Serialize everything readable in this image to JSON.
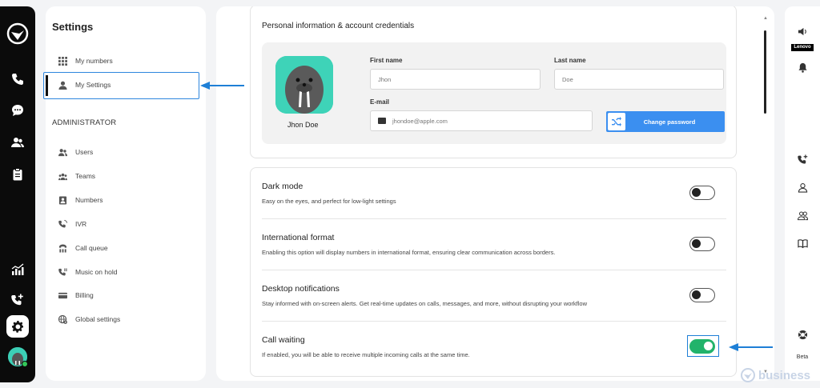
{
  "app": {
    "logo": "app-logo-icon"
  },
  "left_rail": {
    "icons": [
      "phone-icon",
      "chat-icon",
      "contacts-icon",
      "clipboard-icon",
      "analytics-icon",
      "add-call-icon",
      "gear-icon",
      "avatar"
    ]
  },
  "settings": {
    "title": "Settings",
    "items": [
      {
        "label": "My numbers",
        "icon": "grid-icon"
      },
      {
        "label": "My Settings",
        "icon": "user-icon"
      }
    ],
    "admin_label": "ADMINISTRATOR",
    "admin_items": [
      {
        "label": "Users",
        "icon": "users-icon"
      },
      {
        "label": "Teams",
        "icon": "teams-icon"
      },
      {
        "label": "Numbers",
        "icon": "numbers-icon"
      },
      {
        "label": "IVR",
        "icon": "ivr-icon"
      },
      {
        "label": "Call queue",
        "icon": "call-queue-icon"
      },
      {
        "label": "Music on hold",
        "icon": "music-on-hold-icon"
      },
      {
        "label": "Billing",
        "icon": "billing-icon"
      },
      {
        "label": "Global settings",
        "icon": "globe-icon"
      }
    ]
  },
  "profile": {
    "section_title": "Personal information & account credentials",
    "name": "Jhon Doe",
    "first_name_label": "First name",
    "first_name_value": "Jhon",
    "last_name_label": "Last name",
    "last_name_value": "Doe",
    "email_label": "E-mail",
    "email_value": "jhondoe@apple.com",
    "change_password": "Change password"
  },
  "preferences": [
    {
      "title": "Dark mode",
      "desc": "Easy on the eyes, and perfect for low-light settings",
      "enabled": false
    },
    {
      "title": "International format",
      "desc": "Enabling this option will display numbers in international format, ensuring clear communication across borders.",
      "enabled": false
    },
    {
      "title": "Desktop notifications",
      "desc": "Stay informed with on-screen alerts. Get real-time updates on calls, messages, and more, without disrupting your workflow",
      "enabled": false
    },
    {
      "title": "Call waiting",
      "desc": "If enabled, you will be able to receive multiple incoming calls at the same time.",
      "enabled": true
    }
  ],
  "right_rail": {
    "brand": "Lenovo",
    "beta": "Beta",
    "icons": [
      "speaker-icon",
      "bell-icon",
      "add-call-icon",
      "contact-icon",
      "group-icon",
      "book-icon",
      "lifebuoy-icon"
    ]
  },
  "watermark": "business",
  "colors": {
    "accent": "#3b8ff0",
    "toggle_on": "#22b36b",
    "annotation": "#1e7fd6",
    "avatar_bg": "#3ed3b8"
  }
}
